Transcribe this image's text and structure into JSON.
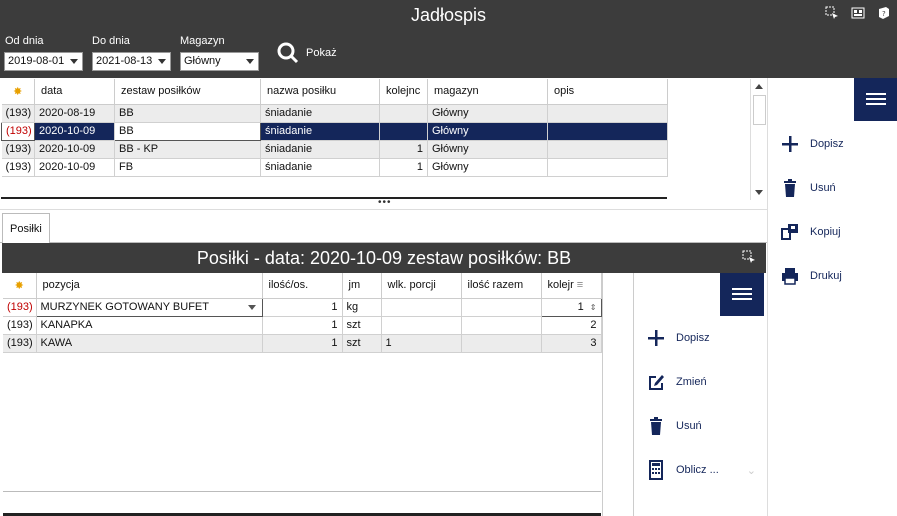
{
  "window": {
    "title": "Jadłospis",
    "icons": [
      "select-icon",
      "layout-icon",
      "help-icon"
    ]
  },
  "filters": {
    "from_label": "Od dnia",
    "from_value": "2019-08-01",
    "to_label": "Do dnia",
    "to_value": "2021-08-13",
    "warehouse_label": "Magazyn",
    "warehouse_value": "Główny",
    "show_label": "Pokaż"
  },
  "menu_grid": {
    "columns": [
      "",
      "data",
      "zestaw posiłków",
      "nazwa posiłku",
      "kolejnc",
      "magazyn",
      "opis"
    ],
    "rows": [
      {
        "id": "(193)",
        "date": "2020-08-19",
        "set": "BB",
        "meal": "śniadanie",
        "order": "",
        "warehouse": "Główny",
        "desc": ""
      },
      {
        "id": "(193)",
        "date": "2020-10-09",
        "set": "BB",
        "meal": "śniadanie",
        "order": "",
        "warehouse": "Główny",
        "desc": ""
      },
      {
        "id": "(193)",
        "date": "2020-10-09",
        "set": "BB - KP",
        "meal": "śniadanie",
        "order": "1",
        "warehouse": "Główny",
        "desc": ""
      },
      {
        "id": "(193)",
        "date": "2020-10-09",
        "set": "FB",
        "meal": "śniadanie",
        "order": "1",
        "warehouse": "Główny",
        "desc": ""
      }
    ]
  },
  "right_actions": {
    "add": "Dopisz",
    "delete": "Usuń",
    "copy": "Kopiuj",
    "print": "Drukuj"
  },
  "tabs": [
    "Posiłki"
  ],
  "meals_panel": {
    "title": "Posiłki - data: 2020-10-09 zestaw posiłków: BB",
    "columns": [
      "",
      "pozycja",
      "ilość/os.",
      "jm",
      "wlk. porcji",
      "ilość razem",
      "kolejr"
    ],
    "rows": [
      {
        "id": "(193)",
        "item": "MURZYNEK GOTOWANY BUFET",
        "qty": "1",
        "unit": "kg",
        "portion": "",
        "total": "",
        "order": "1"
      },
      {
        "id": "(193)",
        "item": "KANAPKA",
        "qty": "1",
        "unit": "szt",
        "portion": "",
        "total": "",
        "order": "2"
      },
      {
        "id": "(193)",
        "item": "KAWA",
        "qty": "1",
        "unit": "szt",
        "portion": "1",
        "total": "",
        "order": "3"
      }
    ]
  },
  "meals_actions": {
    "add": "Dopisz",
    "edit": "Zmień",
    "delete": "Usuń",
    "calc": "Oblicz ..."
  },
  "colors": {
    "header_bg": "#3c3c3c",
    "accent": "#14265a",
    "error_id": "#c00000"
  }
}
